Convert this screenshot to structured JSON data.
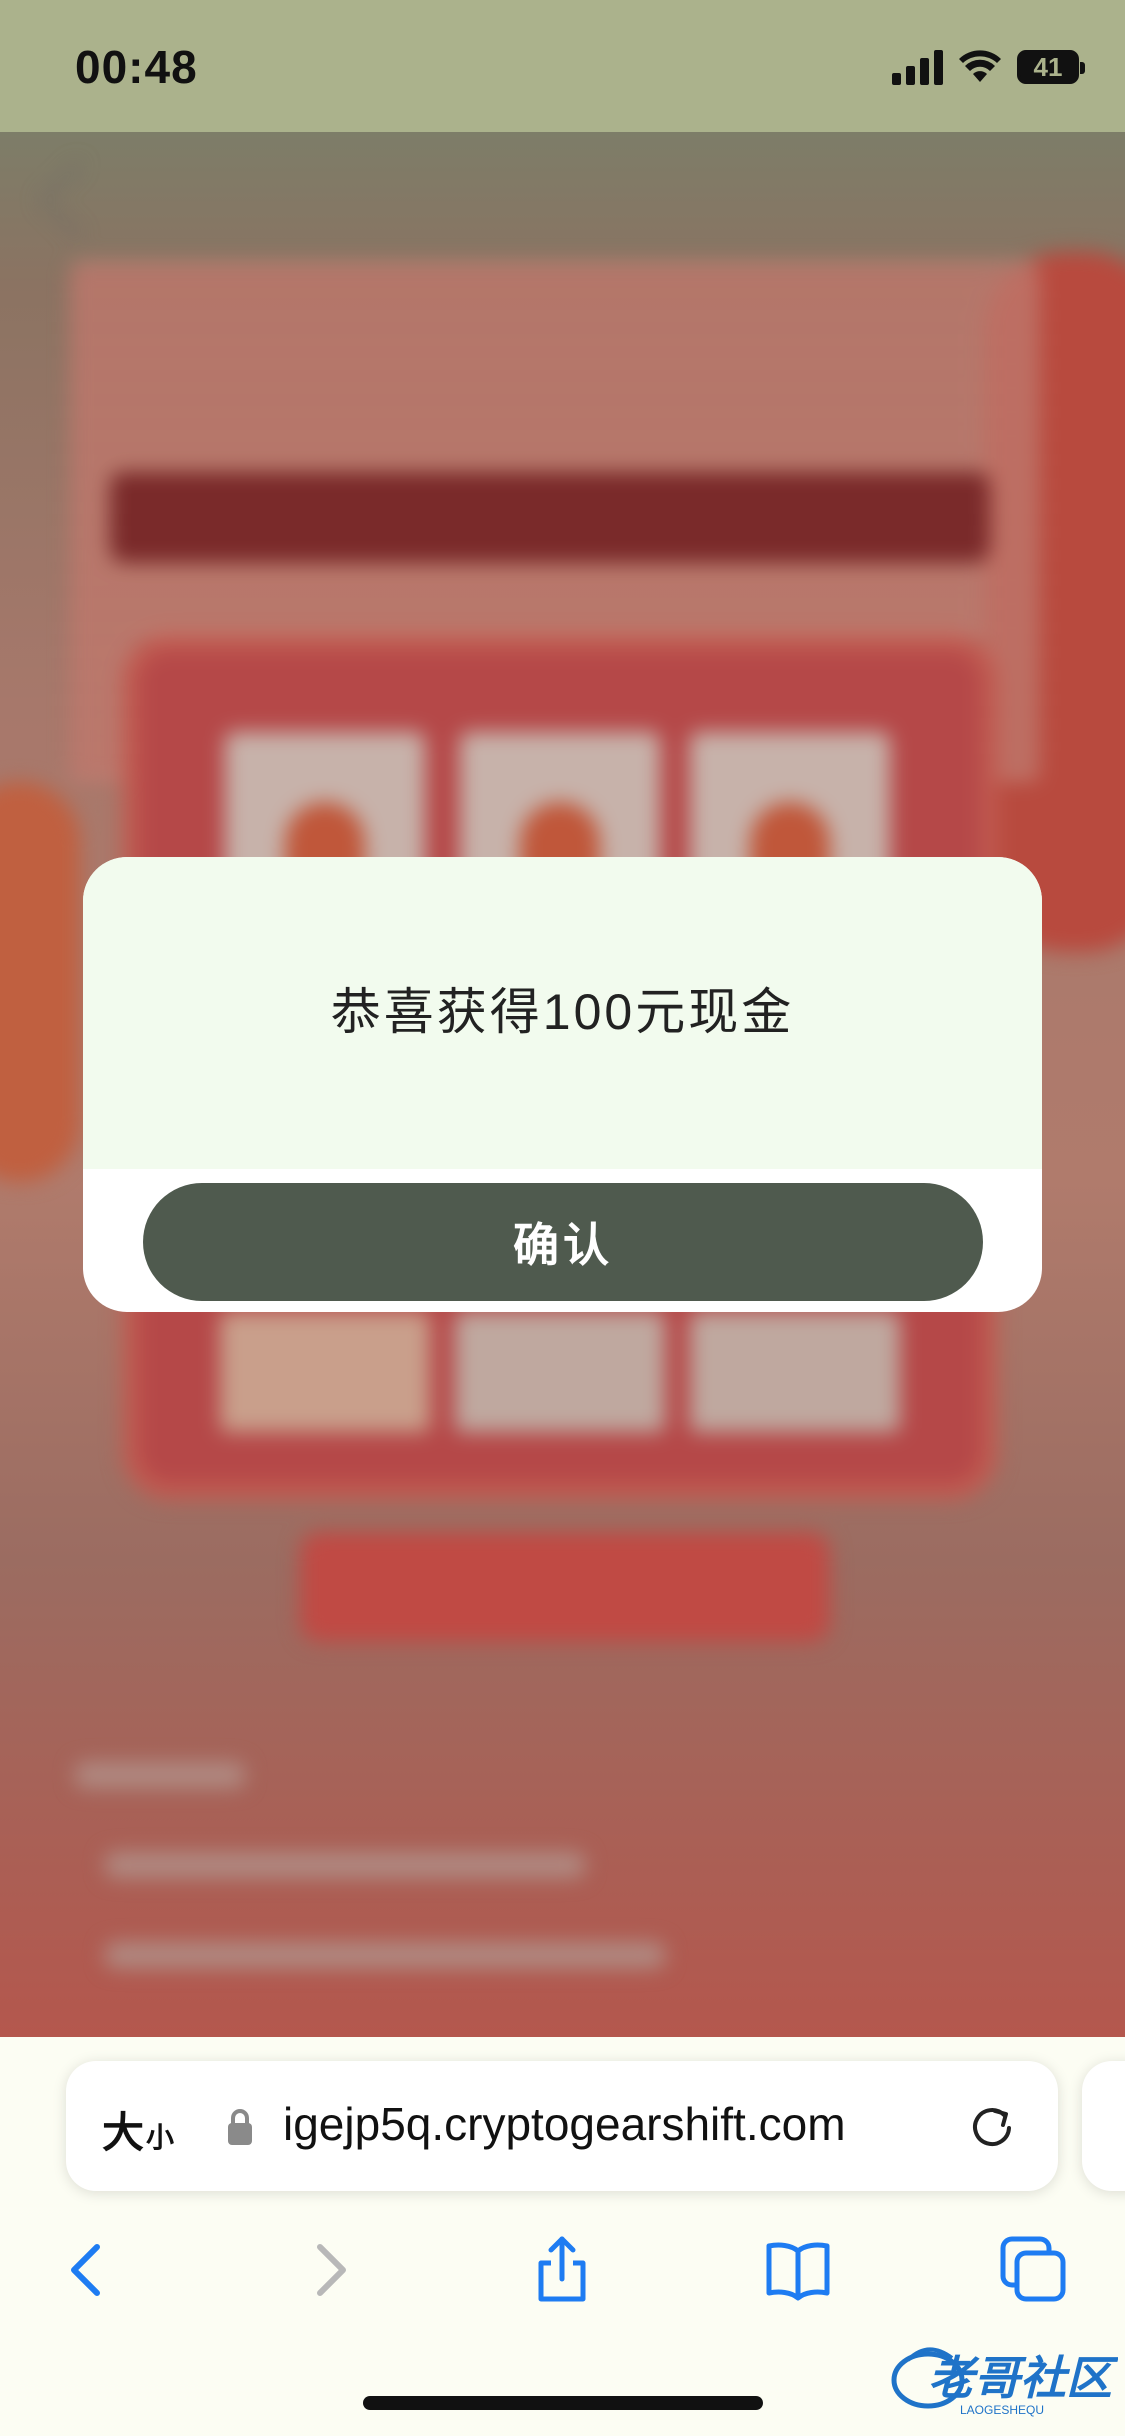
{
  "status_bar": {
    "time": "00:48",
    "battery_level": "41",
    "icons": [
      "cellular-signal-icon",
      "wifi-icon",
      "battery-icon"
    ]
  },
  "modal": {
    "message": "恭喜获得100元现金",
    "confirm_label": "确认"
  },
  "browser": {
    "text_size_big": "大",
    "text_size_small": "小",
    "url": "igejp5q.cryptogearshift.com",
    "toolbar": [
      "back-icon",
      "forward-icon",
      "share-icon",
      "bookmarks-icon",
      "tabs-icon"
    ]
  },
  "watermark": {
    "text": "老哥社区",
    "subtext": "LAOGESHEQU"
  },
  "colors": {
    "status_bar_bg": "#abb28c",
    "modal_body_bg": "#f2fbee",
    "confirm_button_bg": "#4f5a4e",
    "ios_blue": "#1e7cf2"
  }
}
